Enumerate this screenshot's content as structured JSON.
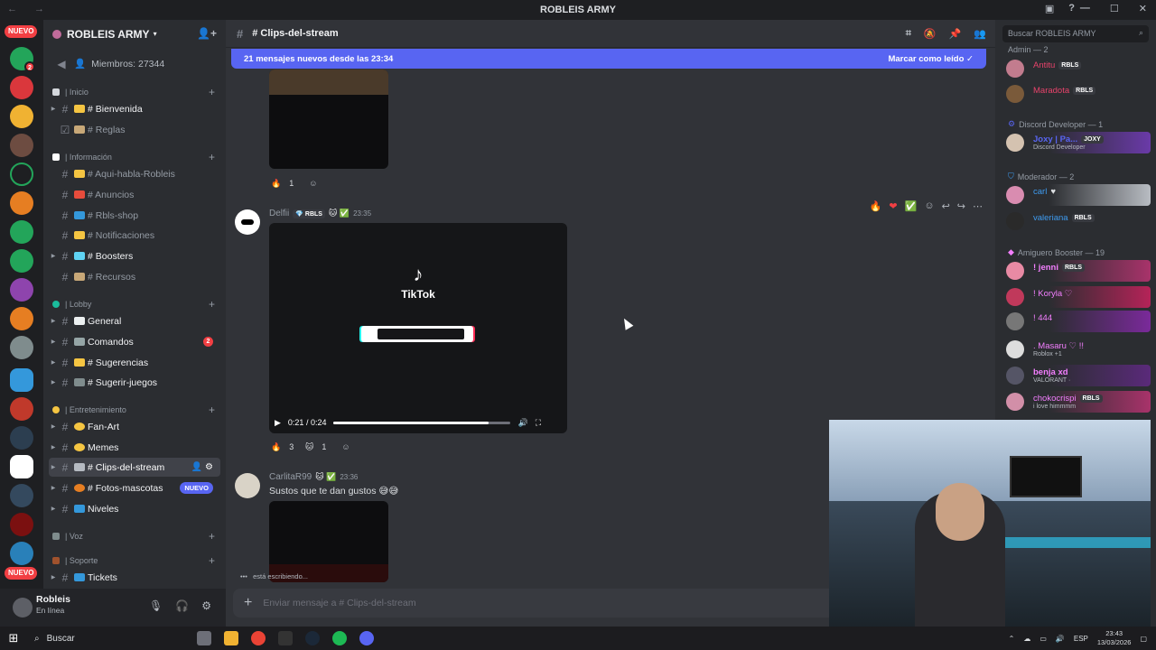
{
  "window": {
    "title": "ROBLEIS ARMY"
  },
  "server": {
    "name": "ROBLEIS ARMY",
    "members_label": "Miembros: 27344",
    "new_pill": "NUEVO"
  },
  "categories": {
    "inicio": "| Inicio",
    "informacion": "| Información",
    "lobby": "| Lobby",
    "entretenimiento": "| Entretenimiento",
    "voz": "| Voz",
    "soporte": "| Soporte"
  },
  "channels": {
    "bienvenida": "# Bienvenida",
    "reglas": "# Reglas",
    "aqui_habla": "# Aqui-habla-Robleis",
    "anuncios": "# Anuncios",
    "rbls_shop": "# Rbls-shop",
    "notificaciones": "# Notificaciones",
    "boosters": "# Boosters",
    "recursos": "# Recursos",
    "general": "General",
    "comandos": "Comandos",
    "comandos_badge": "2",
    "sugerencias": "# Sugerencias",
    "sugerir_juegos": "# Sugerir-juegos",
    "fan_art": "Fan-Art",
    "memes": "Memes",
    "clips": "# Clips-del-stream",
    "fotos": "# Fotos-mascotas",
    "fotos_badge": "NUEVO",
    "niveles": "Niveles",
    "tickets": "Tickets"
  },
  "user_panel": {
    "name": "Robleis",
    "status": "En línea"
  },
  "chat": {
    "header_title": "# Clips-del-stream",
    "new_banner_text": "21 mensajes nuevos desde las 23:34",
    "mark_read": "Marcar como leído",
    "msg1_reaction_count": "1",
    "msg2": {
      "author": "Delfii",
      "tag": "RBLS",
      "time": "23:35",
      "video_brand": "TikTok",
      "video_time": "0:21 / 0:24",
      "video_progress": 0.875,
      "reaction1_count": "3",
      "reaction2_count": "1"
    },
    "msg3": {
      "author": "CarlitaR99",
      "time": "23:36",
      "text": "Sustos que te dan gustos 😅😅"
    },
    "typing": "está escribiendo...",
    "composer_placeholder": "Enviar mensaje a # Clips-del-stream"
  },
  "members": {
    "search_placeholder": "Buscar ROBLEIS ARMY",
    "cat_admin": "Admin — 2",
    "cat_dev": "Discord Developer — 1",
    "cat_mod": "Moderador — 2",
    "cat_booster": "Amiguero Booster — 19",
    "list": [
      {
        "name": "Antitu",
        "tag": "RBLS",
        "sub": "",
        "color": "#e8436b"
      },
      {
        "name": "Maradota",
        "tag": "RBLS",
        "sub": "",
        "color": "#e8436b"
      },
      {
        "name": "Joxy | Pa...",
        "tag": "JOXY",
        "sub": "Discord Developer",
        "color": "#5865f2"
      },
      {
        "name": "carl",
        "tag": "",
        "sub": "",
        "color": "#3e9bf0"
      },
      {
        "name": "valeriana",
        "tag": "RBLS",
        "sub": "",
        "color": "#3e9bf0"
      },
      {
        "name": "! jenni",
        "tag": "RBLS",
        "sub": "",
        "color": "#f47fff"
      },
      {
        "name": "! Koryla ♡",
        "tag": "",
        "sub": "",
        "color": "#f47fff"
      },
      {
        "name": "! 444",
        "tag": "",
        "sub": "",
        "color": "#f47fff"
      },
      {
        "name": ". Masaru ♡ !!",
        "tag": "",
        "sub": "Roblox +1",
        "color": "#f47fff"
      },
      {
        "name": "benja xd",
        "tag": "",
        "sub": "VALORANT ·",
        "color": "#f47fff"
      },
      {
        "name": "chokocrispi",
        "tag": "RBLS",
        "sub": "i love himmmm",
        "color": "#f47fff"
      }
    ]
  },
  "taskbar": {
    "search": "Buscar",
    "lang": "ESP",
    "time": "23:43",
    "date": "13/03/2026"
  },
  "colors": {
    "blurple": "#5865f2",
    "red_badge": "#f23f43",
    "bg_chat": "#313338",
    "bg_sidebar": "#2b2d31"
  }
}
